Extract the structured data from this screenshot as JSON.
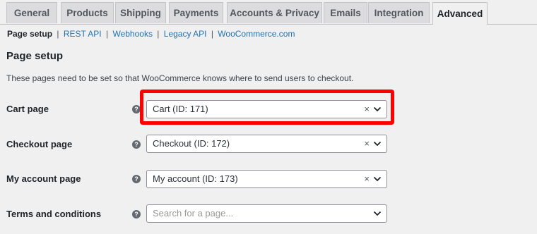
{
  "tabs": [
    {
      "label": "General"
    },
    {
      "label": "Products"
    },
    {
      "label": "Shipping"
    },
    {
      "label": "Payments"
    },
    {
      "label": "Accounts & Privacy"
    },
    {
      "label": "Emails"
    },
    {
      "label": "Integration"
    },
    {
      "label": "Advanced",
      "active": true
    }
  ],
  "subnav": {
    "items": [
      "Page setup",
      "REST API",
      "Webhooks",
      "Legacy API",
      "WooCommerce.com"
    ],
    "separator": "|",
    "current": "Page setup"
  },
  "section": {
    "title": "Page setup",
    "description": "These pages need to be set so that WooCommerce knows where to send users to checkout."
  },
  "help_icon_glyph": "?",
  "clear_glyph": "×",
  "fields": [
    {
      "label": "Cart page",
      "value": "Cart (ID: 171)",
      "placeholder": "",
      "highlighted": true
    },
    {
      "label": "Checkout page",
      "value": "Checkout (ID: 172)",
      "placeholder": ""
    },
    {
      "label": "My account page",
      "value": "My account (ID: 173)",
      "placeholder": ""
    },
    {
      "label": "Terms and conditions",
      "value": "",
      "placeholder": "Search for a page..."
    }
  ],
  "colors": {
    "highlight": "#ff0000",
    "link": "#2271b1",
    "background": "#f0f0f1",
    "tab_inactive": "#dcdcde"
  }
}
